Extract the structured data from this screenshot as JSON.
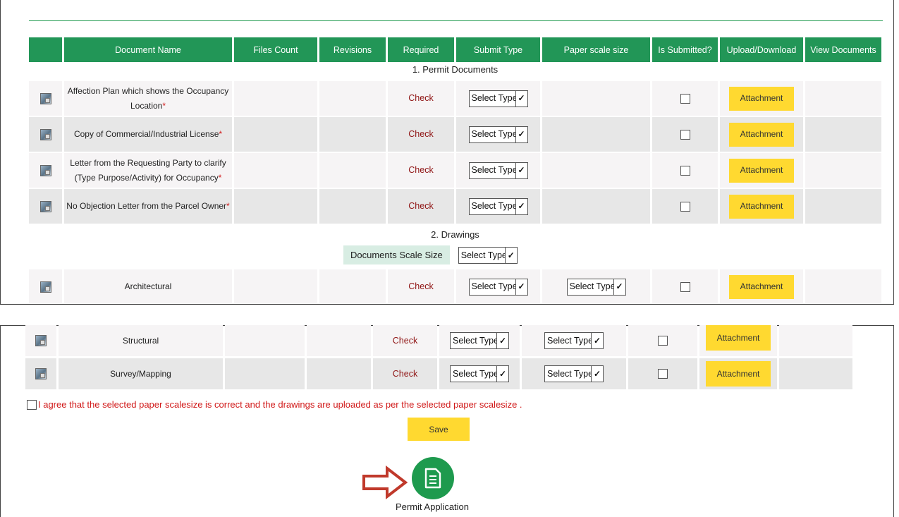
{
  "headers": [
    "",
    "Document Name",
    "Files Count",
    "Revisions",
    "Required",
    "Submit Type",
    "Paper scale size",
    "Is Submitted?",
    "Upload/Download",
    "View Documents"
  ],
  "sections": {
    "permit": "1. Permit Documents",
    "drawings": "2. Drawings"
  },
  "permit_rows": [
    {
      "name_line1": "Affection Plan which shows the Occupancy",
      "name_line2": "Location",
      "required_mark": "*",
      "check": "Check",
      "submit_type": "Select Type",
      "attachment": "Attachment"
    },
    {
      "name_line1": "Copy of Commercial/Industrial License",
      "name_line2": "",
      "required_mark": "*",
      "check": "Check",
      "submit_type": "Select Type",
      "attachment": "Attachment"
    },
    {
      "name_line1": "Letter from the Requesting Party to clarify",
      "name_line2": "(Type Purpose/Activity) for Occupancy",
      "required_mark": "*",
      "check": "Check",
      "submit_type": "Select Type",
      "attachment": "Attachment"
    },
    {
      "name_line1": "No Objection Letter from the Parcel Owner",
      "name_line2": "",
      "required_mark": "*",
      "check": "Check",
      "submit_type": "Select Type",
      "attachment": "Attachment"
    }
  ],
  "scale": {
    "label": "Documents Scale Size",
    "value": "Select Type"
  },
  "drawing_rows": [
    {
      "name": "Architectural",
      "check": "Check",
      "submit_type": "Select Type",
      "paper_scale": "Select Type",
      "attachment": "Attachment"
    },
    {
      "name": "Structural",
      "check": "Check",
      "submit_type": "Select Type",
      "paper_scale": "Select Type",
      "attachment": "Attachment"
    },
    {
      "name": "Survey/Mapping",
      "check": "Check",
      "submit_type": "Select Type",
      "paper_scale": "Select Type",
      "attachment": "Attachment"
    }
  ],
  "agree_text": "I agree that the selected paper scalesize is correct and the drawings are uploaded as per the selected paper scalesize .",
  "save_label": "Save",
  "permit_application": {
    "label": "Permit Application",
    "icon": "document-icon",
    "color": "#1e9a4e"
  },
  "colors": {
    "header_green": "#229657",
    "attachment_yellow": "#ffd930",
    "check_red": "#8f1414",
    "arrow_red": "#c0392b"
  }
}
